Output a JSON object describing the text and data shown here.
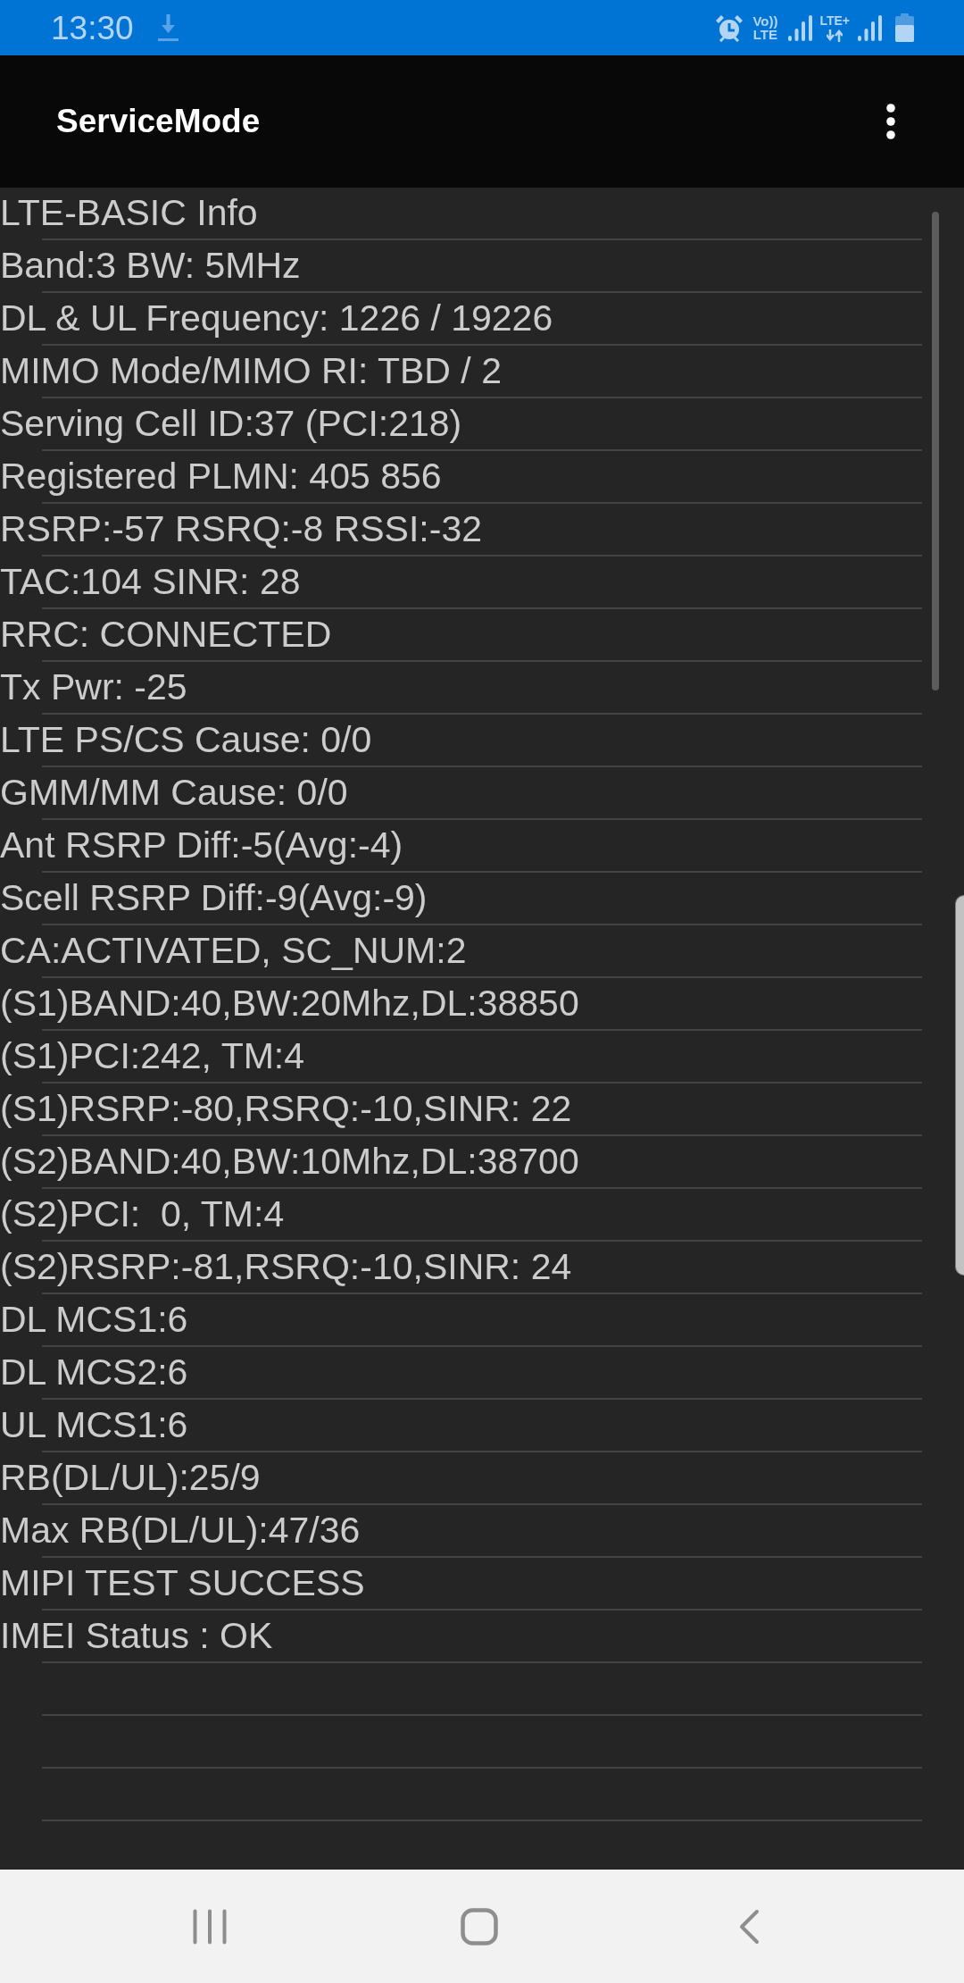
{
  "status_bar": {
    "time": "13:30",
    "volte": {
      "top": "Vo))",
      "bottom": "LTE"
    },
    "network_type": "LTE+"
  },
  "app_bar": {
    "title": "ServiceMode"
  },
  "info_lines": [
    "LTE-BASIC Info",
    "Band:3 BW: 5MHz",
    "DL & UL Frequency: 1226 / 19226",
    "MIMO Mode/MIMO RI: TBD / 2",
    "Serving Cell ID:37 (PCI:218)",
    "Registered PLMN: 405 856",
    "RSRP:-57 RSRQ:-8 RSSI:-32",
    "TAC:104 SINR: 28",
    "RRC: CONNECTED",
    "Tx Pwr: -25",
    "LTE PS/CS Cause: 0/0",
    "GMM/MM Cause: 0/0",
    "Ant RSRP Diff:-5(Avg:-4)",
    "Scell RSRP Diff:-9(Avg:-9)",
    "CA:ACTIVATED, SC_NUM:2",
    "(S1)BAND:40,BW:20Mhz,DL:38850",
    "(S1)PCI:242, TM:4",
    "(S1)RSRP:-80,RSRQ:-10,SINR: 22",
    "(S2)BAND:40,BW:10Mhz,DL:38700",
    "(S2)PCI:  0, TM:4",
    "(S2)RSRP:-81,RSRQ:-10,SINR: 24",
    "DL MCS1:6",
    "DL MCS2:6",
    "UL MCS1:6",
    "RB(DL/UL):25/9",
    "Max RB(DL/UL):47/36",
    "MIPI TEST SUCCESS",
    "IMEI Status : OK"
  ]
}
